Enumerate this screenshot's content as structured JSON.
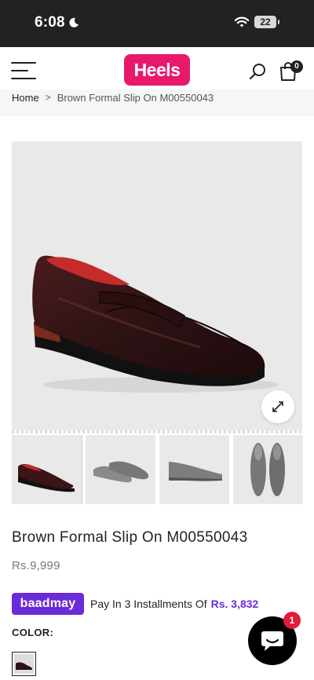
{
  "status_bar": {
    "time": "6:08",
    "battery": "22"
  },
  "header": {
    "logo_text": "Heels",
    "cart_count": "0"
  },
  "breadcrumb": {
    "home": "Home",
    "separator": ">",
    "current": "Brown Formal Slip On M00550043"
  },
  "product": {
    "title": "Brown Formal Slip On M00550043",
    "price": "Rs.9,999",
    "installment": {
      "brand": "baadmay",
      "text": "Pay In 3 Installments Of",
      "amount": "Rs. 3,832"
    },
    "color_label": "COLOR:"
  },
  "chat": {
    "unread_count": "1"
  },
  "colors": {
    "brand_pink": "#e8196a",
    "baadmay_purple": "#6c2bd9",
    "status_bar": "#222222",
    "chat_badge": "#e21c3a"
  },
  "icons": [
    "moon-icon",
    "wifi-icon",
    "menu-icon",
    "search-icon",
    "cart-icon",
    "expand-icon",
    "chat-icon"
  ]
}
